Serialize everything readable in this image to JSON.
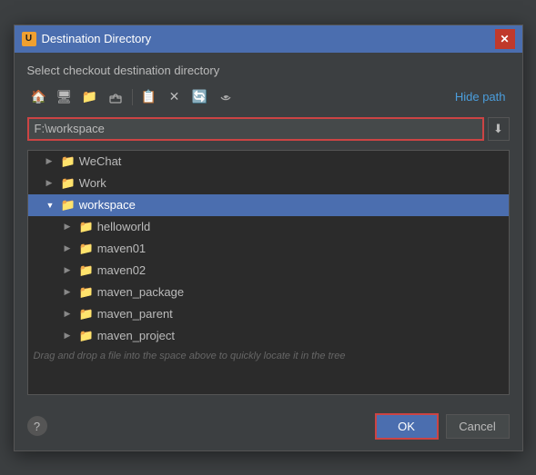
{
  "dialog": {
    "title": "Destination Directory",
    "icon_label": "U",
    "subtitle": "Select checkout destination directory",
    "hide_path_label": "Hide path",
    "path_value": "F:\\workspace",
    "drag_hint": "Drag and drop a file into the space above to quickly locate it in the tree",
    "ok_label": "OK",
    "cancel_label": "Cancel",
    "help_label": "?"
  },
  "toolbar": {
    "btn1_icon": "🏠",
    "btn2_icon": "🖥",
    "btn3_icon": "📁",
    "btn4_icon": "📁",
    "btn5_icon": "📋",
    "btn6_icon": "✕",
    "btn7_icon": "🔄",
    "btn8_icon": "🔗"
  },
  "tree": {
    "items": [
      {
        "label": "WeChat",
        "indent": 1,
        "arrow": "▶",
        "selected": false
      },
      {
        "label": "Work",
        "indent": 1,
        "arrow": "▶",
        "selected": false
      },
      {
        "label": "workspace",
        "indent": 1,
        "arrow": "▼",
        "selected": true
      },
      {
        "label": "helloworld",
        "indent": 2,
        "arrow": "▶",
        "selected": false
      },
      {
        "label": "maven01",
        "indent": 2,
        "arrow": "▶",
        "selected": false
      },
      {
        "label": "maven02",
        "indent": 2,
        "arrow": "▶",
        "selected": false
      },
      {
        "label": "maven_package",
        "indent": 2,
        "arrow": "▶",
        "selected": false
      },
      {
        "label": "maven_parent",
        "indent": 2,
        "arrow": "▶",
        "selected": false
      },
      {
        "label": "maven_project",
        "indent": 2,
        "arrow": "▶",
        "selected": false
      }
    ]
  }
}
